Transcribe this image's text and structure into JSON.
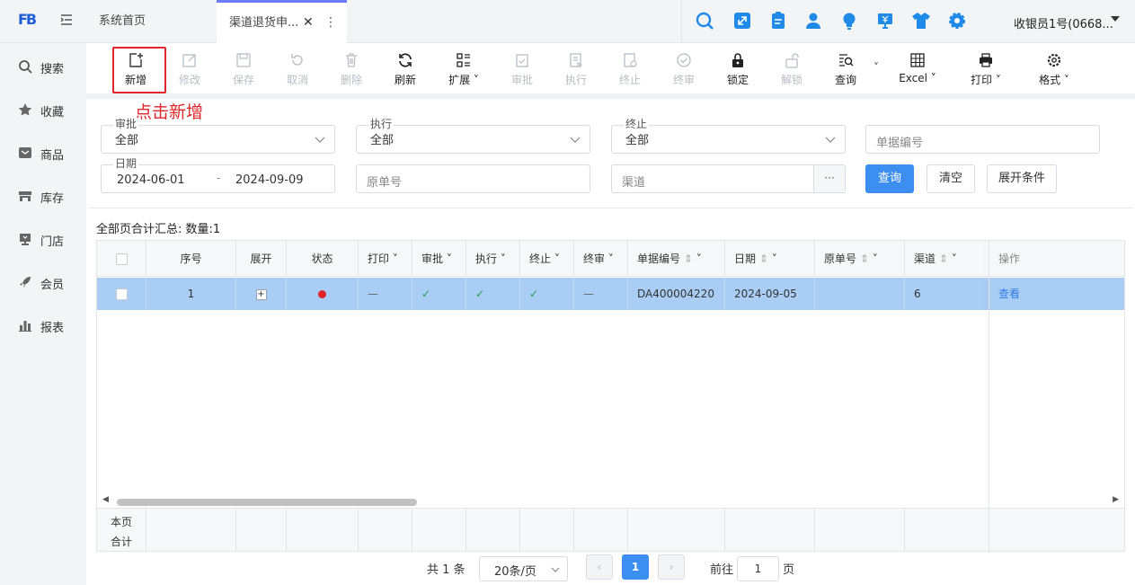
{
  "topbar": {
    "logo_text": "FB",
    "tabs": [
      {
        "label": "系统首页"
      },
      {
        "label": "渠道退货申..."
      }
    ],
    "icons": [
      "search-icon",
      "expand-icon",
      "clipboard-icon",
      "user-icon",
      "lightbulb-icon",
      "money-screen-icon",
      "shirt-icon",
      "gear-icon"
    ],
    "user_label": "收银员1号(0668...",
    "accent": "#1f8ae8"
  },
  "sidebar": {
    "items": [
      {
        "label": "搜索",
        "icon": "search-icon"
      },
      {
        "label": "收藏",
        "icon": "star-icon"
      },
      {
        "label": "商品",
        "icon": "goods-icon"
      },
      {
        "label": "库存",
        "icon": "warehouse-icon"
      },
      {
        "label": "门店",
        "icon": "store-icon"
      },
      {
        "label": "会员",
        "icon": "rocket-icon"
      },
      {
        "label": "报表",
        "icon": "bar-chart-icon"
      }
    ]
  },
  "toolbar": {
    "buttons": [
      {
        "label": "新增",
        "enabled": true
      },
      {
        "label": "修改",
        "enabled": false
      },
      {
        "label": "保存",
        "enabled": false
      },
      {
        "label": "取消",
        "enabled": false
      },
      {
        "label": "删除",
        "enabled": false
      },
      {
        "label": "刷新",
        "enabled": true
      },
      {
        "label": "扩展",
        "enabled": true
      },
      {
        "label": "审批",
        "enabled": false
      },
      {
        "label": "执行",
        "enabled": false
      },
      {
        "label": "终止",
        "enabled": false
      },
      {
        "label": "终审",
        "enabled": false
      },
      {
        "label": "锁定",
        "enabled": true
      },
      {
        "label": "解锁",
        "enabled": false
      },
      {
        "label": "查询",
        "enabled": true
      },
      {
        "label": "Excel",
        "enabled": true
      },
      {
        "label": "打印",
        "enabled": true
      },
      {
        "label": "格式",
        "enabled": true
      }
    ],
    "annotation": "点击新增",
    "annotation_color": "#e0262b"
  },
  "filters": {
    "approve": {
      "label": "审批",
      "value": "全部"
    },
    "execute": {
      "label": "执行",
      "value": "全部"
    },
    "terminate": {
      "label": "终止",
      "value": "全部"
    },
    "doc_no": {
      "placeholder": "单据编号"
    },
    "date": {
      "label": "日期",
      "start": "2024-06-01",
      "sep": "-",
      "end": "2024-09-09"
    },
    "orig_no": {
      "placeholder": "原单号"
    },
    "channel": {
      "placeholder": "渠道",
      "more": "···"
    },
    "query_btn": "查询",
    "clear_btn": "清空",
    "expand_btn": "展开条件"
  },
  "grid": {
    "summary": "全部页合计汇总:  数量:1",
    "columns": [
      "序号",
      "展开",
      "状态",
      "打印",
      "审批",
      "执行",
      "终止",
      "终审",
      "单据编号",
      "日期",
      "原单号",
      "渠道",
      "操作"
    ],
    "rows": [
      {
        "seq": "1",
        "expand": "+",
        "status": "red",
        "print": "—",
        "approve": "✓",
        "execute": "✓",
        "terminate": "✓",
        "final": "—",
        "doc_no": "DA400004220",
        "date": "2024-09-05",
        "orig_no": "",
        "channel": "6",
        "action": "查看"
      }
    ],
    "footer": {
      "line1": "本页",
      "line2": "合计"
    }
  },
  "pagination": {
    "total": "共 1 条",
    "page_size": "20条/页",
    "current": "1",
    "goto_prefix": "前往",
    "goto_value": "1",
    "goto_suffix": "页"
  }
}
